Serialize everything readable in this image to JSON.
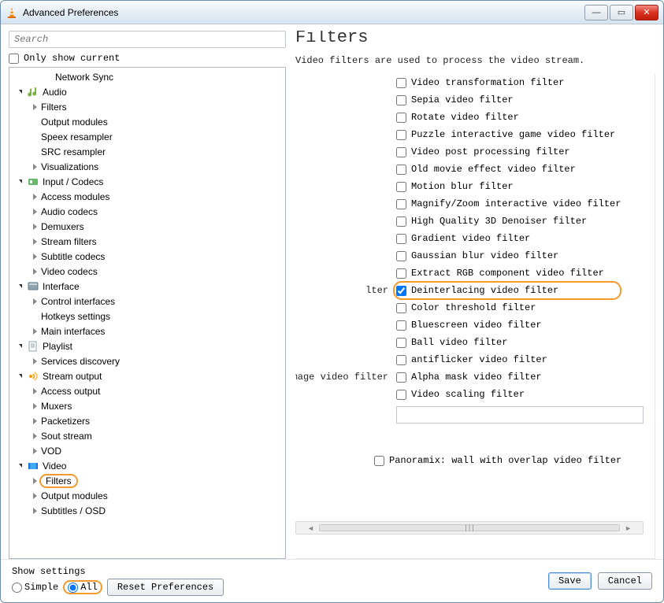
{
  "window": {
    "title": "Advanced Preferences"
  },
  "left": {
    "search_placeholder": "Search",
    "only_show_current": "Only show current"
  },
  "tree": [
    {
      "depth": 2,
      "expand": "",
      "icon": "",
      "label": "Network Sync"
    },
    {
      "depth": 0,
      "expand": "open",
      "icon": "audio",
      "label": "Audio"
    },
    {
      "depth": 1,
      "expand": "closed",
      "icon": "",
      "label": "Filters"
    },
    {
      "depth": 1,
      "expand": "",
      "icon": "",
      "label": "Output modules"
    },
    {
      "depth": 1,
      "expand": "",
      "icon": "",
      "label": "Speex resampler"
    },
    {
      "depth": 1,
      "expand": "",
      "icon": "",
      "label": "SRC resampler"
    },
    {
      "depth": 1,
      "expand": "closed",
      "icon": "",
      "label": "Visualizations"
    },
    {
      "depth": 0,
      "expand": "open",
      "icon": "input",
      "label": "Input / Codecs"
    },
    {
      "depth": 1,
      "expand": "closed",
      "icon": "",
      "label": "Access modules"
    },
    {
      "depth": 1,
      "expand": "closed",
      "icon": "",
      "label": "Audio codecs"
    },
    {
      "depth": 1,
      "expand": "closed",
      "icon": "",
      "label": "Demuxers"
    },
    {
      "depth": 1,
      "expand": "closed",
      "icon": "",
      "label": "Stream filters"
    },
    {
      "depth": 1,
      "expand": "closed",
      "icon": "",
      "label": "Subtitle codecs"
    },
    {
      "depth": 1,
      "expand": "closed",
      "icon": "",
      "label": "Video codecs"
    },
    {
      "depth": 0,
      "expand": "open",
      "icon": "interface",
      "label": "Interface"
    },
    {
      "depth": 1,
      "expand": "closed",
      "icon": "",
      "label": "Control interfaces"
    },
    {
      "depth": 1,
      "expand": "",
      "icon": "",
      "label": "Hotkeys settings"
    },
    {
      "depth": 1,
      "expand": "closed",
      "icon": "",
      "label": "Main interfaces"
    },
    {
      "depth": 0,
      "expand": "open",
      "icon": "playlist",
      "label": "Playlist"
    },
    {
      "depth": 1,
      "expand": "closed",
      "icon": "",
      "label": "Services discovery"
    },
    {
      "depth": 0,
      "expand": "open",
      "icon": "stream",
      "label": "Stream output"
    },
    {
      "depth": 1,
      "expand": "closed",
      "icon": "",
      "label": "Access output"
    },
    {
      "depth": 1,
      "expand": "closed",
      "icon": "",
      "label": "Muxers"
    },
    {
      "depth": 1,
      "expand": "closed",
      "icon": "",
      "label": "Packetizers"
    },
    {
      "depth": 1,
      "expand": "closed",
      "icon": "",
      "label": "Sout stream"
    },
    {
      "depth": 1,
      "expand": "closed",
      "icon": "",
      "label": "VOD"
    },
    {
      "depth": 0,
      "expand": "open",
      "icon": "video",
      "label": "Video"
    },
    {
      "depth": 1,
      "expand": "closed",
      "icon": "",
      "label": "Filters",
      "active": true
    },
    {
      "depth": 1,
      "expand": "closed",
      "icon": "",
      "label": "Output modules"
    },
    {
      "depth": 1,
      "expand": "closed",
      "icon": "",
      "label": "Subtitles / OSD"
    }
  ],
  "right": {
    "title": "Filters",
    "desc": "Video filters are used to process the video stream.",
    "left_labels": {
      "lter": "lter",
      "himage": "h image video filter"
    },
    "filters": [
      {
        "label": "Video transformation filter",
        "checked": false
      },
      {
        "label": "Sepia video filter",
        "checked": false
      },
      {
        "label": "Rotate video filter",
        "checked": false
      },
      {
        "label": "Puzzle interactive game video filter",
        "checked": false
      },
      {
        "label": "Video post processing filter",
        "checked": false
      },
      {
        "label": "Old movie effect video filter",
        "checked": false
      },
      {
        "label": "Motion blur filter",
        "checked": false
      },
      {
        "label": "Magnify/Zoom interactive video filter",
        "checked": false
      },
      {
        "label": "High Quality 3D Denoiser filter",
        "checked": false
      },
      {
        "label": "Gradient video filter",
        "checked": false
      },
      {
        "label": "Gaussian blur video filter",
        "checked": false
      },
      {
        "label": "Extract RGB component video filter",
        "checked": false
      },
      {
        "label": "Deinterlacing video filter",
        "checked": true,
        "highlight": true
      },
      {
        "label": "Color threshold filter",
        "checked": false
      },
      {
        "label": "Bluescreen video filter",
        "checked": false
      },
      {
        "label": "Ball video filter",
        "checked": false
      },
      {
        "label": "antiflicker video filter",
        "checked": false
      },
      {
        "label": "Alpha mask video filter",
        "checked": false
      },
      {
        "label": "Video scaling filter",
        "checked": false
      }
    ],
    "panoramix": "Panoramix: wall with overlap video filter"
  },
  "footer": {
    "show_settings": "Show settings",
    "simple": "Simple",
    "all": "All",
    "reset": "Reset Preferences",
    "save": "Save",
    "cancel": "Cancel"
  }
}
